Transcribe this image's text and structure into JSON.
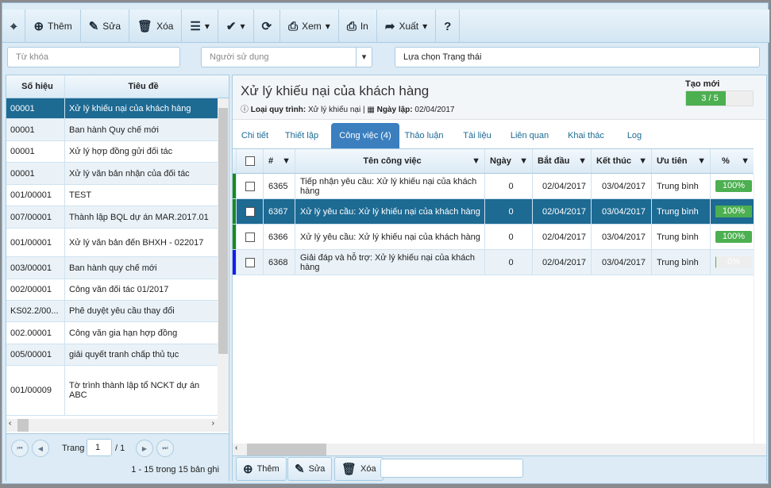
{
  "toolbar": {
    "them": "Thêm",
    "sua": "Sửa",
    "xoa": "Xóa",
    "xem": "Xem",
    "in": "In",
    "xuat": "Xuất"
  },
  "filters": {
    "keyword_placeholder": "Từ khóa",
    "user_placeholder": "Người sử dụng",
    "status_value": "Lựa chọn Trạng thái"
  },
  "list": {
    "col1": "Số hiệu",
    "col2": "Tiêu đề",
    "rows": [
      {
        "code": "00001",
        "title": "Xử lý khiếu nại của khách hàng"
      },
      {
        "code": "00001",
        "title": "Ban hành Quy chế mới"
      },
      {
        "code": "00001",
        "title": "Xử lý hợp đồng gửi đối tác"
      },
      {
        "code": "00001",
        "title": "Xử lý văn bản nhận của đối tác"
      },
      {
        "code": "001/00001",
        "title": "TEST"
      },
      {
        "code": "007/00001",
        "title": "Thành lập BQL dự án MAR.2017.01"
      },
      {
        "code": "001/00001",
        "title": "Xử lý văn bản đến BHXH - 022017"
      },
      {
        "code": "003/00001",
        "title": "Ban hành quy chế mới"
      },
      {
        "code": "002/00001",
        "title": "Công văn đối tác 01/2017"
      },
      {
        "code": "KS02.2/00...",
        "title": "Phê duyệt yêu cầu thay đổi"
      },
      {
        "code": "002.00001",
        "title": "Công văn gia hạn hợp đồng"
      },
      {
        "code": "005/00001",
        "title": "giải quyết tranh chấp thủ tục"
      },
      {
        "code": "001/00009",
        "title": "Tờ trình thành lập tổ NCKT dự án ABC"
      }
    ]
  },
  "pager": {
    "label": "Trang",
    "page": "1",
    "total": "/ 1",
    "summary": "1 - 15 trong 15 bản ghi"
  },
  "detail": {
    "title": "Xử lý khiếu nại của khách hàng",
    "type_label": "Loại quy trình:",
    "type_value": "Xử lý khiếu nại |",
    "date_label": "Ngày lập:",
    "date_value": "02/04/2017",
    "status_label": "Tạo mới",
    "progress_text": "3 / 5",
    "progress_fraction": 0.6
  },
  "tabs": [
    "Chi tiết",
    "Thiết lập",
    "Công việc (4)",
    "Thảo luận",
    "Tài liệu",
    "Liên quan",
    "Khai thác",
    "Log"
  ],
  "grid": {
    "headers": [
      "#",
      "Tên công việc",
      "Ngày",
      "Bắt đầu",
      "Kết thúc",
      "Ưu tiên",
      "%"
    ],
    "rows": [
      {
        "id": "6365",
        "name": "Tiếp nhận yêu cầu: Xử lý khiếu nại của khách hàng",
        "days": "0",
        "start": "02/04/2017",
        "end": "03/04/2017",
        "priority": "Trung bình",
        "pct": "100%",
        "pct_value": 100,
        "marker": "#1a8a1a"
      },
      {
        "id": "6367",
        "name": "Xử lý yêu cầu: Xử lý khiếu nại của khách hàng",
        "days": "0",
        "start": "02/04/2017",
        "end": "03/04/2017",
        "priority": "Trung bình",
        "pct": "100%",
        "pct_value": 100,
        "marker": "#1a8a1a"
      },
      {
        "id": "6366",
        "name": "Xử lý yêu cầu: Xử lý khiếu nại của khách hàng",
        "days": "0",
        "start": "02/04/2017",
        "end": "03/04/2017",
        "priority": "Trung bình",
        "pct": "100%",
        "pct_value": 100,
        "marker": "#1a8a1a"
      },
      {
        "id": "6368",
        "name": "Giải đáp và hỗ trợ: Xử lý khiếu nại của khách hàng",
        "days": "0",
        "start": "02/04/2017",
        "end": "03/04/2017",
        "priority": "Trung bình",
        "pct": "0%",
        "pct_value": 0,
        "marker": "#1a1aee"
      }
    ]
  },
  "bottom": {
    "them": "Thêm",
    "sua": "Sửa",
    "xoa": "Xóa"
  }
}
